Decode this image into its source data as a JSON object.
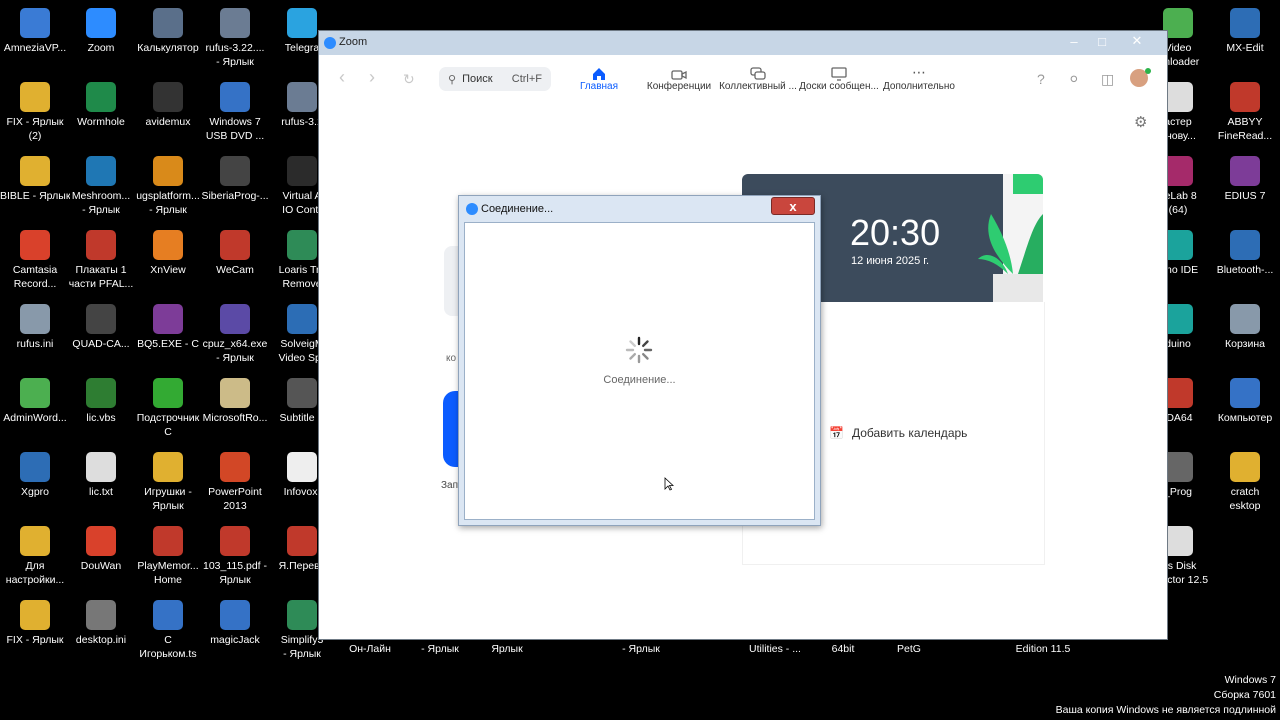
{
  "desktop": {
    "icons": [
      {
        "label": "AmneziaVP...",
        "color": "#3a7bd5"
      },
      {
        "label": "Zoom",
        "color": "#2d8cff"
      },
      {
        "label": "Калькулятор",
        "color": "#5a6f8a"
      },
      {
        "label": "rufus-3.22....\n- Ярлык",
        "color": "#6b7c93"
      },
      {
        "label": "Telegra",
        "color": "#2aa3e0"
      },
      {
        "label": "FIX - Ярлык\n(2)",
        "color": "#e0b030"
      },
      {
        "label": "Wormhole",
        "color": "#1f8a4a"
      },
      {
        "label": "avidemux",
        "color": "#333333"
      },
      {
        "label": "Windows 7\nUSB DVD ...",
        "color": "#3572c6"
      },
      {
        "label": "rufus-3.1",
        "color": "#6b7c93"
      },
      {
        "label": "BIBLE - Ярлык",
        "color": "#e0b030"
      },
      {
        "label": "Meshroom...\n- Ярлык",
        "color": "#1f77b4"
      },
      {
        "label": "ugsplatform...\n- Ярлык",
        "color": "#d98a1a"
      },
      {
        "label": "SiberiaProg-...",
        "color": "#444444"
      },
      {
        "label": "Virtual A\nIO Contr",
        "color": "#2b2b2b"
      },
      {
        "label": "Camtasia\nRecord...",
        "color": "#d9412b"
      },
      {
        "label": "Плакаты 1\nчасти PFAL...",
        "color": "#c0392b"
      },
      {
        "label": "XnView",
        "color": "#e67e22"
      },
      {
        "label": "WeCam",
        "color": "#c0392b"
      },
      {
        "label": "Loaris Tro\nRemove",
        "color": "#2e8b57"
      },
      {
        "label": "rufus.ini",
        "color": "#8899aa"
      },
      {
        "label": "QUAD-CA...",
        "color": "#444444"
      },
      {
        "label": "BQ5.EXE - C",
        "color": "#7d3c98"
      },
      {
        "label": "cpuz_x64.exe\n- Ярлык",
        "color": "#5b4aa6"
      },
      {
        "label": "SolveigM\nVideo Spli",
        "color": "#2c6db5"
      },
      {
        "label": "AdminWord...",
        "color": "#4caf50"
      },
      {
        "label": "lic.vbs",
        "color": "#2e7d32"
      },
      {
        "label": "Подстрочник\nC",
        "color": "#33aa33"
      },
      {
        "label": "MicrosoftRo...",
        "color": "#ccbb88"
      },
      {
        "label": "Subtitle E",
        "color": "#555555"
      },
      {
        "label": "Xgpro",
        "color": "#2d6db5"
      },
      {
        "label": "lic.txt",
        "color": "#dddddd"
      },
      {
        "label": "Игрушки -\nЯрлык",
        "color": "#e0b030"
      },
      {
        "label": "PowerPoint\n2013",
        "color": "#d24726"
      },
      {
        "label": "Infovox.",
        "color": "#eeeeee"
      },
      {
        "label": "Для\nнастройки...",
        "color": "#e0b030"
      },
      {
        "label": "DouWan",
        "color": "#d9412b"
      },
      {
        "label": "PlayMemor...\nHome",
        "color": "#c0392b"
      },
      {
        "label": "103_115.pdf -\nЯрлык",
        "color": "#c0392b"
      },
      {
        "label": "Я.Перево",
        "color": "#c0392b"
      },
      {
        "label": "FIX - Ярлык",
        "color": "#e0b030"
      },
      {
        "label": "desktop.ini",
        "color": "#777777"
      },
      {
        "label": "C\nИгорьком.ts",
        "color": "#3572c6"
      },
      {
        "label": "magicJack",
        "color": "#3572c6"
      },
      {
        "label": "Simplify3\n- Ярлык",
        "color": "#2e8b57"
      },
      {
        "label": "Video\nwnloader",
        "color": "#4caf50"
      },
      {
        "label": "MX-Edit",
        "color": "#2d6db5"
      },
      {
        "label": "астер\nанову...",
        "color": "#dddddd"
      },
      {
        "label": "ABBYY\nFineRead...",
        "color": "#c0392b"
      },
      {
        "label": "veLab 8\n(64)",
        "color": "#a52a6a"
      },
      {
        "label": "EDIUS 7",
        "color": "#7d3c98"
      },
      {
        "label": "uino IDE",
        "color": "#1ba39c"
      },
      {
        "label": "Bluetooth-...",
        "color": "#2d6db5"
      },
      {
        "label": "duino",
        "color": "#1ba39c"
      },
      {
        "label": "Корзина",
        "color": "#8899aa"
      },
      {
        "label": "IDA64",
        "color": "#c0392b"
      },
      {
        "label": "Компьютер",
        "color": "#3572c6"
      },
      {
        "label": "_Prog",
        "color": "#666666"
      },
      {
        "label": "cratch\nesktop",
        "color": "#e0b030"
      },
      {
        "label": "nis Disk\nDirector 12.5",
        "color": "#dddddd"
      }
    ],
    "bottom_labels": [
      "Он-Лайн",
      "- Ярлык",
      "Ярлык",
      "- Ярлык",
      "Utilities - ...",
      "64bit",
      "PetG",
      "Edition 11.5"
    ]
  },
  "zoom_window": {
    "title": "Zoom",
    "search": {
      "label": "Поиск",
      "shortcut": "Ctrl+F"
    },
    "tabs": [
      {
        "label": "Главная",
        "icon": "home-icon",
        "active": true
      },
      {
        "label": "Конференции",
        "icon": "video-icon",
        "active": false
      },
      {
        "label": "Коллективный ...",
        "icon": "chat-icon",
        "active": false
      },
      {
        "label": "Доски сообщен...",
        "icon": "whiteboard-icon",
        "active": false
      },
      {
        "label": "Дополнительно",
        "icon": "more-icon",
        "active": false
      }
    ],
    "clock": {
      "time": "20:30",
      "date": "12 июня 2025 г."
    },
    "add_calendar": "Добавить календарь",
    "left_partial": {
      "text1": "ко",
      "text2": "Запл"
    }
  },
  "dialog": {
    "title": "Соединение...",
    "close": "x",
    "status": "Соединение..."
  },
  "watermark": {
    "line1": "Windows 7",
    "line2": "Сборка 7601",
    "line3": "Ваша копия Windows не является подлинной"
  }
}
